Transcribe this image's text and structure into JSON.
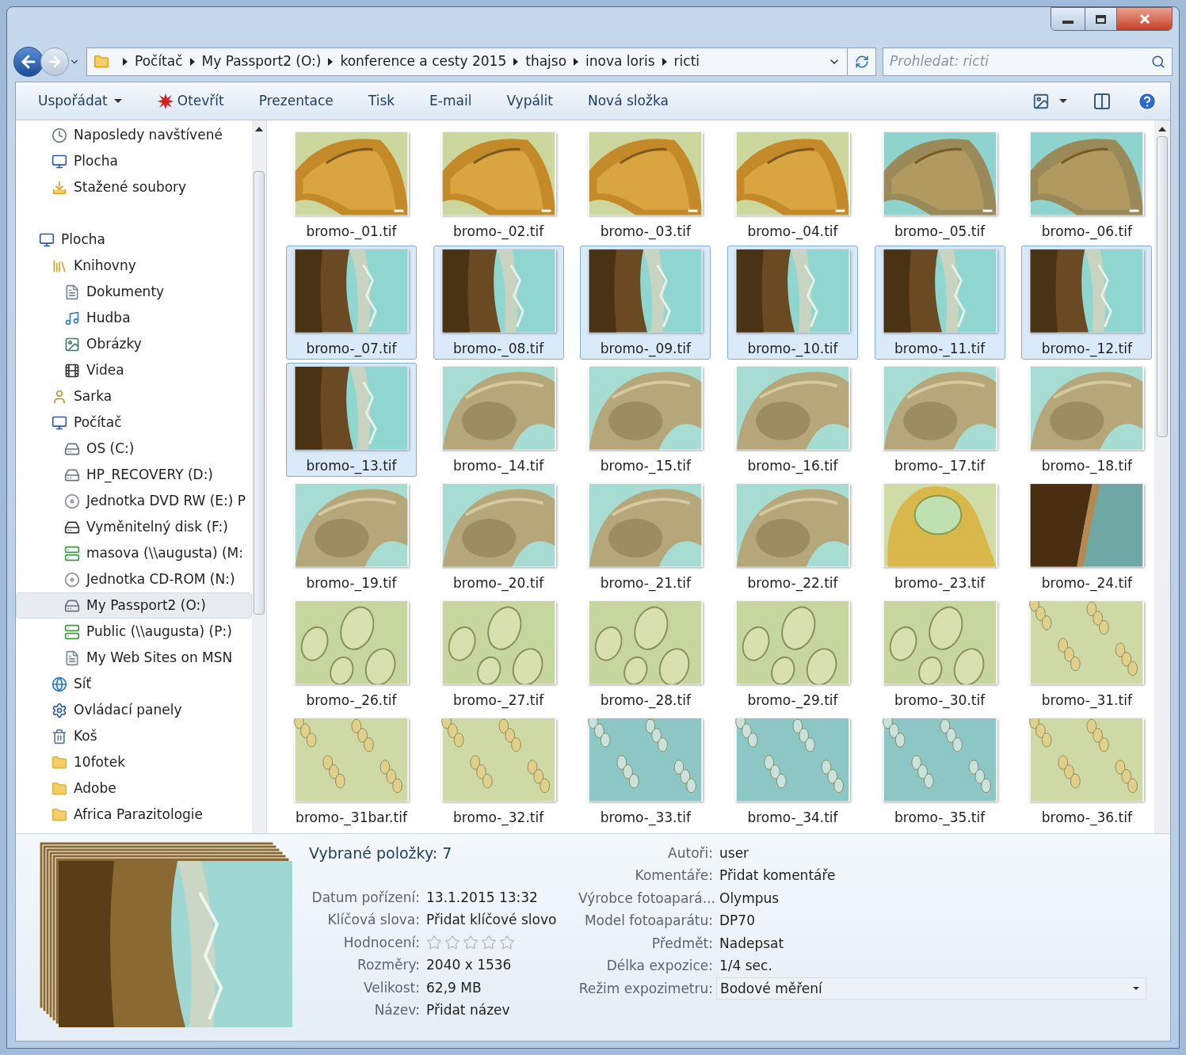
{
  "breadcrumb": [
    "Počítač",
    "My Passport2 (O:)",
    "konference a cesty 2015",
    "thajso",
    "inova loris",
    "ricti"
  ],
  "search": {
    "placeholder": "Prohledat: ricti"
  },
  "toolbar": [
    {
      "label": "Uspořádat",
      "kind": "menu"
    },
    {
      "label": "Otevřít",
      "kind": "open"
    },
    {
      "label": "Prezentace",
      "kind": "plain"
    },
    {
      "label": "Tisk",
      "kind": "plain"
    },
    {
      "label": "E-mail",
      "kind": "plain"
    },
    {
      "label": "Vypálit",
      "kind": "plain"
    },
    {
      "label": "Nová složka",
      "kind": "plain"
    }
  ],
  "favorites": [
    {
      "label": "Naposledy navštívené",
      "kind": "recent",
      "selected": false
    },
    {
      "label": "Plocha",
      "kind": "desktop",
      "selected": false
    },
    {
      "label": "Stažené soubory",
      "kind": "download",
      "selected": false
    }
  ],
  "tree": [
    {
      "label": "Plocha",
      "kind": "desktop",
      "selected": false,
      "children": [
        {
          "label": "Knihovny",
          "kind": "library",
          "selected": false,
          "children": [
            {
              "label": "Dokumenty",
              "kind": "document",
              "selected": false
            },
            {
              "label": "Hudba",
              "kind": "music",
              "selected": false
            },
            {
              "label": "Obrázky",
              "kind": "pictures",
              "selected": false
            },
            {
              "label": "Videa",
              "kind": "video",
              "selected": false
            }
          ]
        },
        {
          "label": "Sarka",
          "kind": "user",
          "selected": false
        },
        {
          "label": "Počítač",
          "kind": "computer",
          "selected": false,
          "children": [
            {
              "label": "OS (C:)",
              "kind": "drive",
              "selected": false
            },
            {
              "label": "HP_RECOVERY (D:)",
              "kind": "drive",
              "selected": false
            },
            {
              "label": "Jednotka DVD RW (E:) P",
              "kind": "disc",
              "selected": false
            },
            {
              "label": "Vyměnitelný disk (F:)",
              "kind": "removable",
              "selected": false
            },
            {
              "label": "masova (\\\\augusta) (M:",
              "kind": "netdrive",
              "selected": false
            },
            {
              "label": "Jednotka CD-ROM (N:)",
              "kind": "disc",
              "selected": false
            },
            {
              "label": "My Passport2 (O:)",
              "kind": "drive",
              "selected": true
            },
            {
              "label": "Public (\\\\augusta) (P:)",
              "kind": "netdrive",
              "selected": false
            },
            {
              "label": "My Web Sites on MSN",
              "kind": "document",
              "selected": false
            }
          ]
        },
        {
          "label": "Síť",
          "kind": "network",
          "selected": false
        },
        {
          "label": "Ovládací panely",
          "kind": "control",
          "selected": false
        },
        {
          "label": "Koš",
          "kind": "bin",
          "selected": false
        },
        {
          "label": "10fotek",
          "kind": "folder",
          "selected": false
        },
        {
          "label": "Adobe",
          "kind": "folder",
          "selected": false
        },
        {
          "label": "Africa Parazitologie",
          "kind": "folder",
          "selected": false
        }
      ]
    }
  ],
  "files": [
    {
      "name": "bromo-_01.tif",
      "kind": "gold",
      "selected": false
    },
    {
      "name": "bromo-_02.tif",
      "kind": "gold",
      "selected": false
    },
    {
      "name": "bromo-_03.tif",
      "kind": "gold",
      "selected": false
    },
    {
      "name": "bromo-_04.tif",
      "kind": "gold",
      "selected": false
    },
    {
      "name": "bromo-_05.tif",
      "kind": "teal",
      "selected": false
    },
    {
      "name": "bromo-_06.tif",
      "kind": "teal",
      "selected": false
    },
    {
      "name": "bromo-_07.tif",
      "kind": "closeup",
      "selected": true
    },
    {
      "name": "bromo-_08.tif",
      "kind": "closeup",
      "selected": true
    },
    {
      "name": "bromo-_09.tif",
      "kind": "closeup",
      "selected": true
    },
    {
      "name": "bromo-_10.tif",
      "kind": "closeup",
      "selected": true
    },
    {
      "name": "bromo-_11.tif",
      "kind": "closeup",
      "selected": true
    },
    {
      "name": "bromo-_12.tif",
      "kind": "closeup",
      "selected": true
    },
    {
      "name": "bromo-_13.tif",
      "kind": "closeup",
      "selected": true
    },
    {
      "name": "bromo-_14.tif",
      "kind": "pale",
      "selected": false
    },
    {
      "name": "bromo-_15.tif",
      "kind": "pale",
      "selected": false
    },
    {
      "name": "bromo-_16.tif",
      "kind": "pale",
      "selected": false
    },
    {
      "name": "bromo-_17.tif",
      "kind": "pale",
      "selected": false
    },
    {
      "name": "bromo-_18.tif",
      "kind": "pale",
      "selected": false
    },
    {
      "name": "bromo-_19.tif",
      "kind": "pale",
      "selected": false
    },
    {
      "name": "bromo-_20.tif",
      "kind": "pale",
      "selected": false
    },
    {
      "name": "bromo-_21.tif",
      "kind": "pale",
      "selected": false
    },
    {
      "name": "bromo-_22.tif",
      "kind": "pale",
      "selected": false
    },
    {
      "name": "bromo-_23.tif",
      "kind": "bulb",
      "selected": false
    },
    {
      "name": "bromo-_24.tif",
      "kind": "edge",
      "selected": false
    },
    {
      "name": "bromo-_26.tif",
      "kind": "eggs",
      "selected": false
    },
    {
      "name": "bromo-_27.tif",
      "kind": "eggs",
      "selected": false
    },
    {
      "name": "bromo-_28.tif",
      "kind": "eggs",
      "selected": false
    },
    {
      "name": "bromo-_29.tif",
      "kind": "eggs",
      "selected": false
    },
    {
      "name": "bromo-_30.tif",
      "kind": "eggs",
      "selected": false
    },
    {
      "name": "bromo-_31.tif",
      "kind": "cellsgreen",
      "selected": false
    },
    {
      "name": "bromo-_31bar.tif",
      "kind": "cellsgreen",
      "selected": false
    },
    {
      "name": "bromo-_32.tif",
      "kind": "cellsgreen",
      "selected": false
    },
    {
      "name": "bromo-_33.tif",
      "kind": "cellsteal",
      "selected": false
    },
    {
      "name": "bromo-_34.tif",
      "kind": "cellsteal",
      "selected": false
    },
    {
      "name": "bromo-_35.tif",
      "kind": "cellsteal",
      "selected": false
    },
    {
      "name": "bromo-_36.tif",
      "kind": "cellsgreen",
      "selected": false
    }
  ],
  "details": {
    "title": "Vybrané položky: 7",
    "left": [
      {
        "label": "Datum pořízení:",
        "value": "13.1.2015 13:32"
      },
      {
        "label": "Klíčová slova:",
        "value": "Přidat klíčové slovo"
      },
      {
        "label": "Hodnocení:",
        "kind": "rating",
        "stars": 0
      },
      {
        "label": "Rozměry:",
        "value": "2040 x 1536"
      },
      {
        "label": "Velikost:",
        "value": "62,9 MB"
      },
      {
        "label": "Název:",
        "value": "Přidat název"
      }
    ],
    "right": [
      {
        "label": "Autoři:",
        "value": "user"
      },
      {
        "label": "Komentáře:",
        "value": "Přidat komentáře"
      },
      {
        "label": "Výrobce fotoapará...",
        "value": "Olympus"
      },
      {
        "label": "Model fotoaparátu:",
        "value": "DP70"
      },
      {
        "label": "Předmět:",
        "value": "Nadepsat"
      },
      {
        "label": "Délka expozice:",
        "value": "1/4 sec."
      },
      {
        "label": "Režim expozimetru:",
        "value": "Bodové měření",
        "kind": "dropdown"
      }
    ]
  }
}
